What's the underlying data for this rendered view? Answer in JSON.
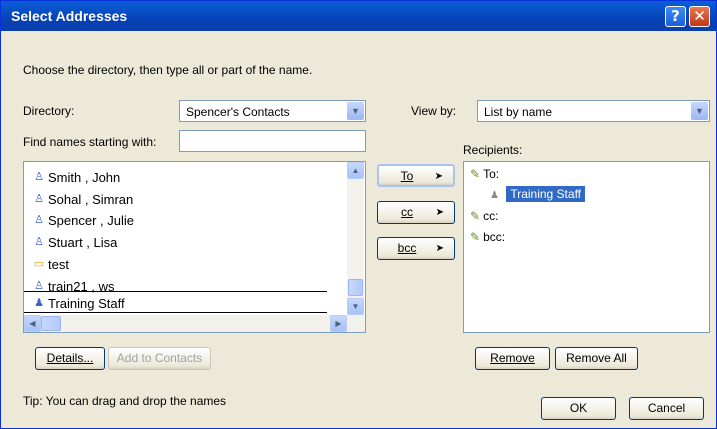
{
  "window": {
    "title": "Select Addresses"
  },
  "instruction": "Choose the directory, then type all or part of the name.",
  "directory": {
    "label": "Directory:",
    "value": "Spencer's Contacts"
  },
  "view_by": {
    "label": "View by:",
    "value": "List by name"
  },
  "find": {
    "label": "Find names starting with:",
    "value": ""
  },
  "recipients_label": "Recipients:",
  "contacts": [
    {
      "name": "Smith , John",
      "icon": "person-icon"
    },
    {
      "name": "Sohal , Simran",
      "icon": "person-icon"
    },
    {
      "name": "Spencer , Julie",
      "icon": "person-icon"
    },
    {
      "name": "Stuart , Lisa",
      "icon": "person-icon"
    },
    {
      "name": "test",
      "icon": "card-icon"
    },
    {
      "name": "train21 , ws",
      "icon": "person-icon"
    },
    {
      "name": "Training Staff",
      "icon": "group-icon"
    }
  ],
  "buttons": {
    "to": "To",
    "cc": "cc",
    "bcc": "bcc",
    "details": "Details...",
    "add_to_contacts": "Add to Contacts",
    "remove": "Remove",
    "remove_all": "Remove All",
    "ok": "OK",
    "cancel": "Cancel"
  },
  "recipients": {
    "to_label": "To:",
    "to_entries": [
      "Training Staff"
    ],
    "cc_label": "cc:",
    "bcc_label": "bcc:"
  },
  "tip": "Tip: You can drag and drop the names",
  "colors": {
    "titlebar": "#0a5fd8",
    "selection": "#316ac5",
    "dialog_bg": "#ece9d8"
  }
}
